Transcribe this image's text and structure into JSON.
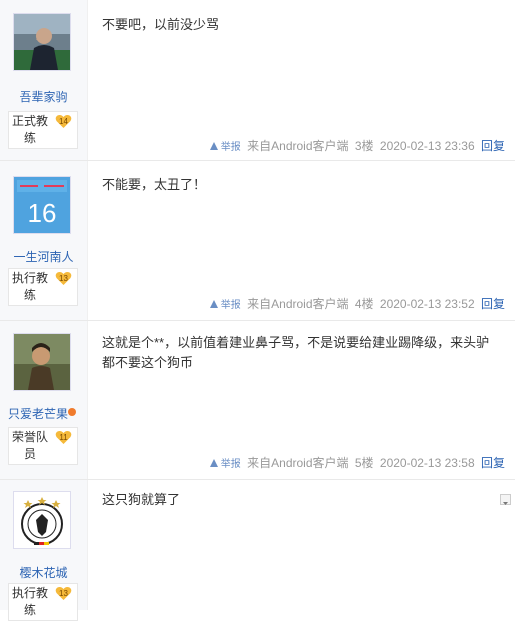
{
  "posts": [
    {
      "username": "吾辈家驹",
      "badge_line1": "正式教",
      "badge_line2": "练",
      "level": "14",
      "content": "不要吧，以前没少骂",
      "report": "举报",
      "source": "来自Android客户端",
      "floor": "3楼",
      "time": "2020-02-13 23:36",
      "reply": "回复"
    },
    {
      "username": "一生河南人",
      "badge_line1": "执行教",
      "badge_line2": "练",
      "level": "13",
      "content": "不能要，太丑了！",
      "avatar_text": "16",
      "report": "举报",
      "source": "来自Android客户端",
      "floor": "4楼",
      "time": "2020-02-13 23:52",
      "reply": "回复"
    },
    {
      "username": "只爱老芒果",
      "badge_line1": "荣誉队",
      "badge_line2": "员",
      "level": "11",
      "content": "这就是个**，以前值着建业鼻子骂，不是说要给建业踢降级，来头驴都不要这个狗币",
      "report": "举报",
      "source": "来自Android客户端",
      "floor": "5楼",
      "time": "2020-02-13 23:58",
      "reply": "回复"
    },
    {
      "username": "樱木花城",
      "badge_line1": "执行教",
      "badge_line2": "练",
      "level": "13",
      "content": "这只狗就算了"
    }
  ],
  "colors": {
    "link": "#2d64b3",
    "meta": "#999999",
    "level_badge": "#f5b93a"
  }
}
